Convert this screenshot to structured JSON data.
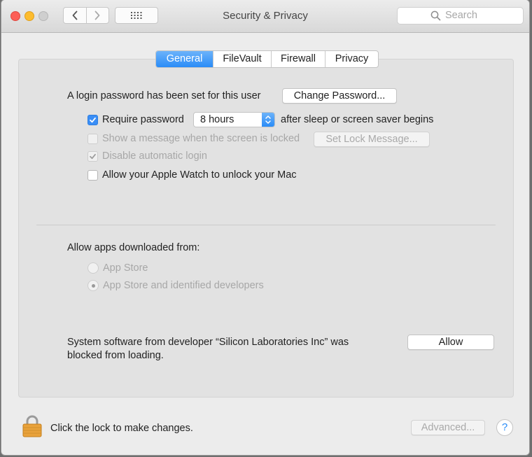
{
  "window": {
    "title": "Security & Privacy"
  },
  "toolbar": {
    "back_icon": "chevron-left-icon",
    "forward_icon": "chevron-right-icon",
    "grid_icon": "grid-icon",
    "search_placeholder": "Search"
  },
  "tabs": [
    {
      "label": "General",
      "active": true
    },
    {
      "label": "FileVault",
      "active": false
    },
    {
      "label": "Firewall",
      "active": false
    },
    {
      "label": "Privacy",
      "active": false
    }
  ],
  "general": {
    "login_password_text": "A login password has been set for this user",
    "change_password_label": "Change Password...",
    "require_password": {
      "label": "Require password",
      "checked": true,
      "selected": "8 hours",
      "suffix": "after sleep or screen saver begins"
    },
    "show_message": {
      "label": "Show a message when the screen is locked",
      "checked": false,
      "enabled": false,
      "button": "Set Lock Message..."
    },
    "disable_auto_login": {
      "label": "Disable automatic login",
      "checked": true,
      "enabled": false
    },
    "apple_watch": {
      "label": "Allow your Apple Watch to unlock your Mac",
      "checked": false
    },
    "allow_apps_heading": "Allow apps downloaded from:",
    "allow_apps_options": [
      {
        "label": "App Store",
        "selected": false
      },
      {
        "label": "App Store and identified developers",
        "selected": true
      }
    ],
    "blocked_text_line1": "System software from developer “Silicon Laboratories Inc” was",
    "blocked_text_line2": "blocked from loading.",
    "allow_button": "Allow"
  },
  "footer": {
    "lock_text": "Click the lock to make changes.",
    "advanced_label": "Advanced...",
    "help_label": "?"
  },
  "colors": {
    "accent": "#2a8cf7",
    "close": "#fc5f57",
    "minimize": "#fdbc2e"
  }
}
